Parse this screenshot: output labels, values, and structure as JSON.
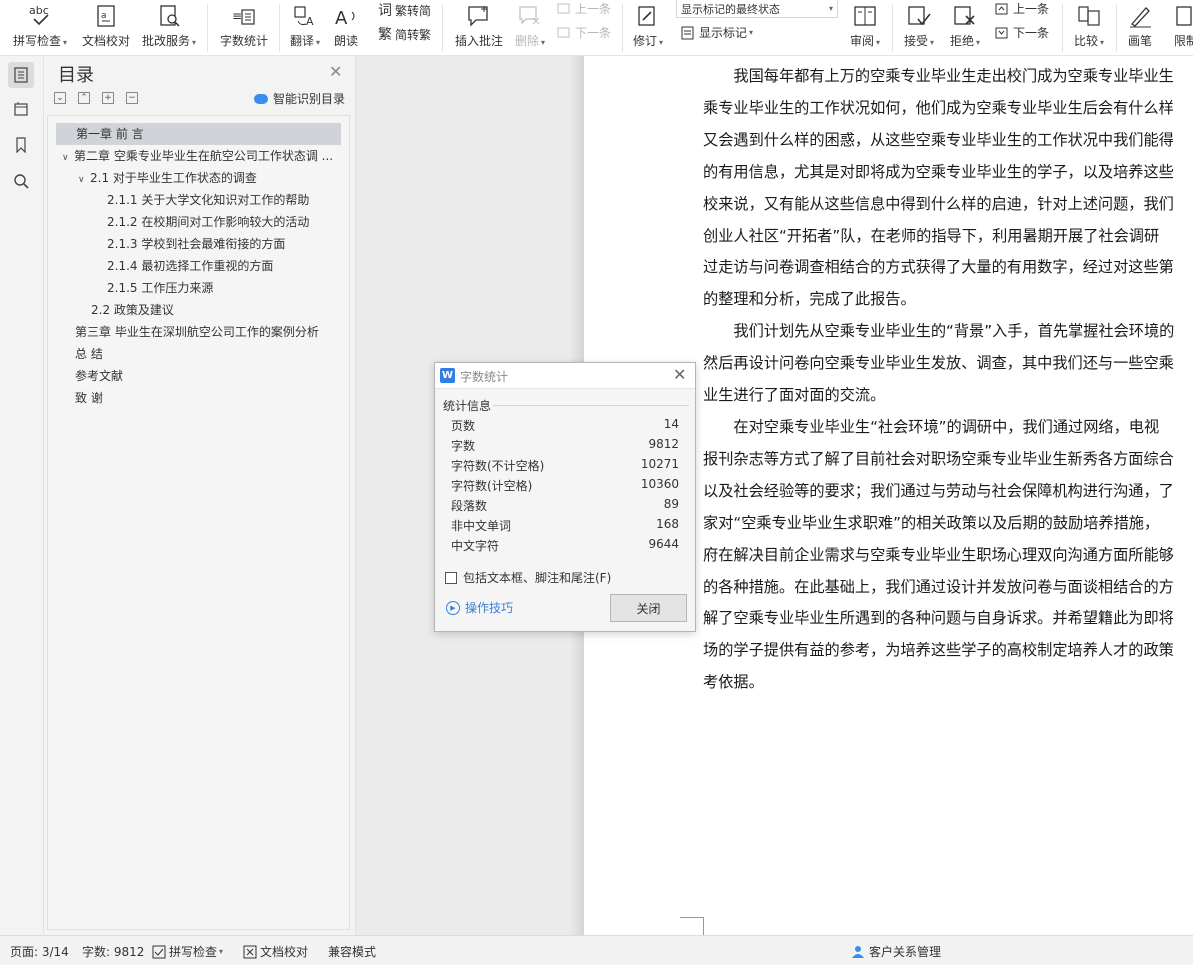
{
  "ribbon": {
    "spell_check": "拼写检查",
    "doc_proofread": "文档校对",
    "review_service": "批改服务",
    "word_count": "字数统计",
    "translate": "翻译",
    "read_aloud": "朗读",
    "trad_to_simp": "繁转简",
    "simp_to_trad": "简转繁",
    "insert_comment": "插入批注",
    "delete": "删除",
    "prev_comment": "上一条",
    "next_comment": "下一条",
    "revise": "修订",
    "markup_state": "显示标记的最终状态",
    "show_markup": "显示标记",
    "review": "审阅",
    "accept": "接受",
    "reject": "拒绝",
    "prev_change": "上一条",
    "next_change": "下一条",
    "compare": "比较",
    "pen": "画笔",
    "restrict": "限制"
  },
  "toc": {
    "title": "目录",
    "smart_detect": "智能识别目录",
    "items": [
      {
        "label": "第一章  前    言"
      },
      {
        "label": "第二章  空乘专业毕业生在航空公司工作状态调 ..."
      },
      {
        "label": "2.1  对于毕业生工作状态的调查"
      },
      {
        "label": "2.1.1 关于大学文化知识对工作的帮助"
      },
      {
        "label": "2.1.2  在校期间对工作影响较大的活动"
      },
      {
        "label": "2.1.3 学校到社会最难衔接的方面"
      },
      {
        "label": "2.1.4 最初选择工作重视的方面"
      },
      {
        "label": "2.1.5 工作压力来源"
      },
      {
        "label": "2.2  政策及建议"
      },
      {
        "label": "第三章  毕业生在深圳航空公司工作的案例分析"
      },
      {
        "label": "总    结"
      },
      {
        "label": "参考文献"
      },
      {
        "label": "致    谢"
      }
    ]
  },
  "document": {
    "lines": [
      "　　我国每年都有上万的空乘专业毕业生走出校门成为空乘专业毕业生",
      "乘专业毕业生的工作状况如何，他们成为空乘专业毕业生后会有什么样",
      "又会遇到什么样的困惑，从这些空乘专业毕业生的工作状况中我们能得",
      "的有用信息，尤其是对即将成为空乘专业毕业生的学子，以及培养这些",
      "校来说，又有能从这些信息中得到什么样的启迪，针对上述问题，我们",
      "创业人社区“开拓者”队，在老师的指导下，利用暑期开展了社会调研",
      "过走访与问卷调查相结合的方式获得了大量的有用数字，经过对这些第",
      "的整理和分析，完成了此报告。",
      "　　我们计划先从空乘专业毕业生的“背景”入手，首先掌握社会环境的",
      "然后再设计问卷向空乘专业毕业生发放、调查，其中我们还与一些空乘",
      "业生进行了面对面的交流。",
      "　　在对空乘专业毕业生“社会环境”的调研中，我们通过网络，电视",
      "报刊杂志等方式了解了目前社会对职场空乘专业毕业生新秀各方面综合",
      "以及社会经验等的要求；我们通过与劳动与社会保障机构进行沟通，了",
      "家对“空乘专业毕业生求职难”的相关政策以及后期的鼓励培养措施，",
      "府在解决目前企业需求与空乘专业毕业生职场心理双向沟通方面所能够",
      "的各种措施。在此基础上，我们通过设计并发放问卷与面谈相结合的方",
      "解了空乘专业毕业生所遇到的各种问题与自身诉求。并希望籍此为即将",
      "场的学子提供有益的参考，为培养这些学子的高校制定培养人才的政策",
      "考依据。"
    ]
  },
  "dialog": {
    "title": "字数统计",
    "group": "统计信息",
    "stats": [
      {
        "label": "页数",
        "value": "14"
      },
      {
        "label": "字数",
        "value": "9812"
      },
      {
        "label": "字符数(不计空格)",
        "value": "10271"
      },
      {
        "label": "字符数(计空格)",
        "value": "10360"
      },
      {
        "label": "段落数",
        "value": "89"
      },
      {
        "label": "非中文单词",
        "value": "168"
      },
      {
        "label": "中文字符",
        "value": "9644"
      }
    ],
    "include_label": "包括文本框、脚注和尾注(F)",
    "tips": "操作技巧",
    "close": "关闭"
  },
  "status": {
    "page": "页面: 3/14",
    "words": "字数: 9812",
    "spell": "拼写检查",
    "proof": "文档校对",
    "compat": "兼容模式",
    "crm": "客户关系管理"
  },
  "colors": {
    "accent": "#2f7ee6",
    "link": "#3a7fd4"
  }
}
